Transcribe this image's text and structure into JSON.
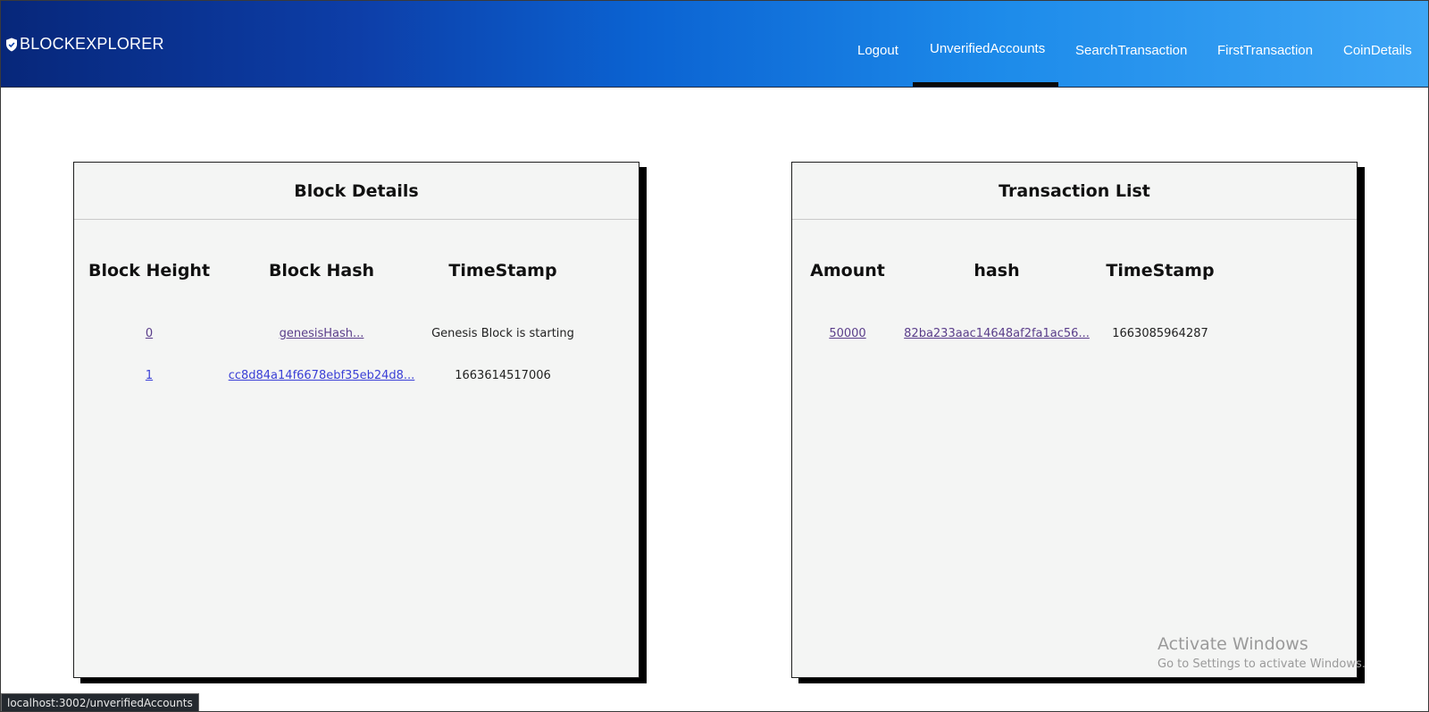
{
  "navbar": {
    "brand": "BLOCKEXPLORER",
    "links": [
      {
        "label": "Logout"
      },
      {
        "label": "UnverifiedAccounts",
        "active": true
      },
      {
        "label": "SearchTransaction"
      },
      {
        "label": "FirstTransaction"
      },
      {
        "label": "CoinDetails"
      }
    ]
  },
  "block_details": {
    "title": "Block Details",
    "columns": [
      "Block Height",
      "Block Hash",
      "TimeStamp"
    ],
    "rows": [
      {
        "height": "0",
        "hash": "genesisHash...",
        "timestamp": "Genesis Block is starting"
      },
      {
        "height": "1",
        "hash": "cc8d84a14f6678ebf35eb24d8...",
        "timestamp": "1663614517006"
      }
    ]
  },
  "transaction_list": {
    "title": "Transaction List",
    "columns": [
      "Amount",
      "hash",
      "TimeStamp"
    ],
    "rows": [
      {
        "amount": "50000",
        "hash": "82ba233aac14648af2fa1ac56...",
        "timestamp": "1663085964287"
      }
    ]
  },
  "watermark": {
    "title": "Activate Windows",
    "subtitle": "Go to Settings to activate Windows."
  },
  "statusbar": {
    "url": "localhost:3002/unverifiedAccounts"
  },
  "colors": {
    "nav_gradient_start": "#07277a",
    "nav_gradient_end": "#3ea6f5",
    "panel_bg": "#f4f5f4",
    "visited_link": "#5a3d8a",
    "link": "#3a3fd6"
  }
}
